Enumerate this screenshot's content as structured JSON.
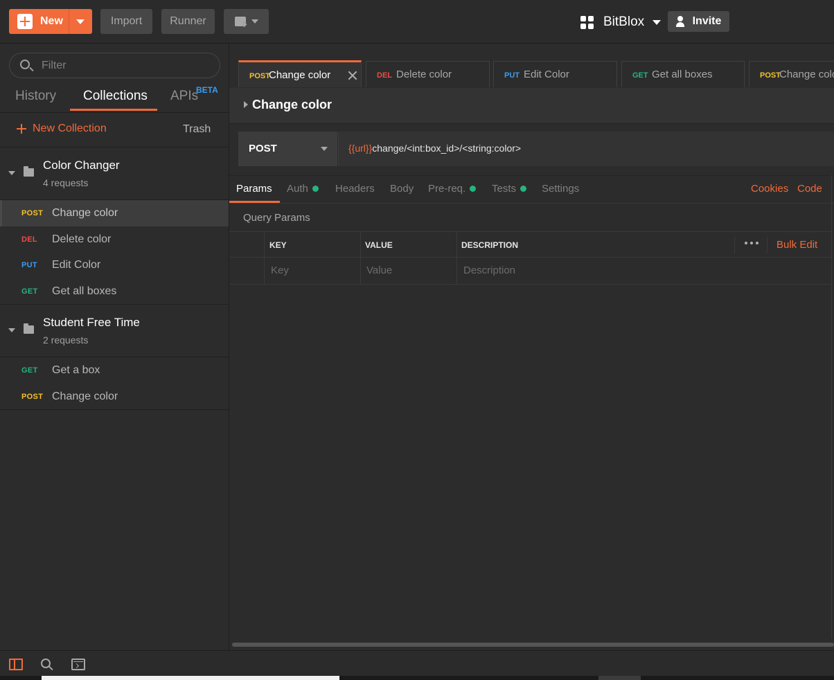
{
  "colors": {
    "accent": "#f26b3a",
    "post": "#f7c22c",
    "del": "#ed4b48",
    "put": "#3d9cf0",
    "get": "#26b47f",
    "dot": "#26b47f"
  },
  "topbar": {
    "new_label": "New",
    "import_label": "Import",
    "runner_label": "Runner",
    "workspace_name": "BitBlox",
    "invite_label": "Invite"
  },
  "sidebar": {
    "filter_placeholder": "Filter",
    "tabs": {
      "history": "History",
      "collections": "Collections",
      "apis": "APIs",
      "apis_badge": "BETA"
    },
    "new_collection_label": "New Collection",
    "trash_label": "Trash",
    "collections": [
      {
        "name": "Color Changer",
        "count": "4 requests",
        "requests": [
          {
            "method": "POST",
            "name": "Change color"
          },
          {
            "method": "DEL",
            "name": "Delete color"
          },
          {
            "method": "PUT",
            "name": "Edit Color"
          },
          {
            "method": "GET",
            "name": "Get all boxes"
          }
        ]
      },
      {
        "name": "Student Free Time",
        "count": "2 requests",
        "requests": [
          {
            "method": "GET",
            "name": "Get a box"
          },
          {
            "method": "POST",
            "name": "Change color"
          }
        ]
      }
    ]
  },
  "main": {
    "tabs": [
      {
        "method": "POST",
        "name": "Change color"
      },
      {
        "method": "DEL",
        "name": "Delete color"
      },
      {
        "method": "PUT",
        "name": "Edit Color"
      },
      {
        "method": "GET",
        "name": "Get all boxes"
      },
      {
        "method": "POST",
        "name": "Change color"
      }
    ],
    "request_title": "Change color",
    "method": "POST",
    "url_var": "{{url}}",
    "url_path": "change/<int:box_id>/<string:color>",
    "request_tabs": {
      "params": "Params",
      "auth": "Auth",
      "headers": "Headers",
      "body": "Body",
      "prereq": "Pre-req.",
      "tests": "Tests",
      "settings": "Settings",
      "cookies": "Cookies",
      "code": "Code"
    },
    "query_params_label": "Query Params",
    "table": {
      "key_header": "KEY",
      "value_header": "VALUE",
      "description_header": "DESCRIPTION",
      "bulk_edit": "Bulk Edit",
      "key_placeholder": "Key",
      "value_placeholder": "Value",
      "description_placeholder": "Description"
    }
  }
}
